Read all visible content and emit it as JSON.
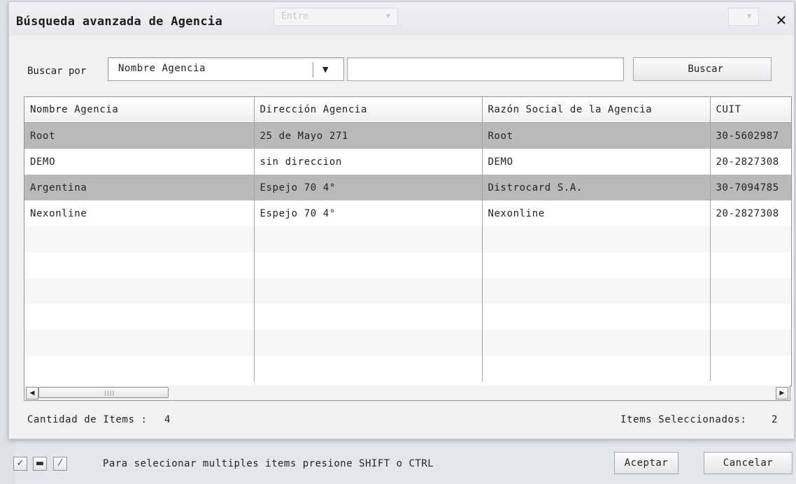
{
  "dialog": {
    "title": "Búsqueda avanzada de Agencia"
  },
  "background": {
    "ghost_select_1": "Entre"
  },
  "search": {
    "label": "Buscar por",
    "selected_field": "Nombre Agencia",
    "query": "",
    "button_label": "Buscar"
  },
  "grid": {
    "columns": [
      "Nombre Agencia",
      "Dirección Agencia",
      "Razón Social de la Agencia",
      "CUIT"
    ],
    "rows": [
      {
        "nombre": "Root",
        "direccion": "25 de Mayo 271",
        "razon": "Root",
        "cuit": "30-5602987",
        "selected": true
      },
      {
        "nombre": "DEMO",
        "direccion": "sin direccion",
        "razon": "DEMO",
        "cuit": "20-2827308",
        "selected": false
      },
      {
        "nombre": "Argentina",
        "direccion": "Espejo 70 4°",
        "razon": "Distrocard S.A.",
        "cuit": "30-7094785",
        "selected": true
      },
      {
        "nombre": "Nexonline",
        "direccion": "Espejo 70 4°",
        "razon": "Nexonline",
        "cuit": "20-2827308",
        "selected": false
      }
    ],
    "empty_rows": 6
  },
  "status": {
    "count_label": "Cantidad de Items :",
    "count_value": "4",
    "selected_label": "Items Seleccionados:",
    "selected_value": "2"
  },
  "footer": {
    "note": "Para selecionar multiples items presione SHIFT o CTRL",
    "accept_label": "Aceptar",
    "cancel_label": "Cancelar",
    "icons": [
      "select-all-icon",
      "select-none-icon",
      "invert-selection-icon"
    ]
  },
  "colors": {
    "selected_row": "#b9b9b9",
    "alt_row": "#f6f6f6",
    "dialog_bg": "#f1f1f1"
  }
}
